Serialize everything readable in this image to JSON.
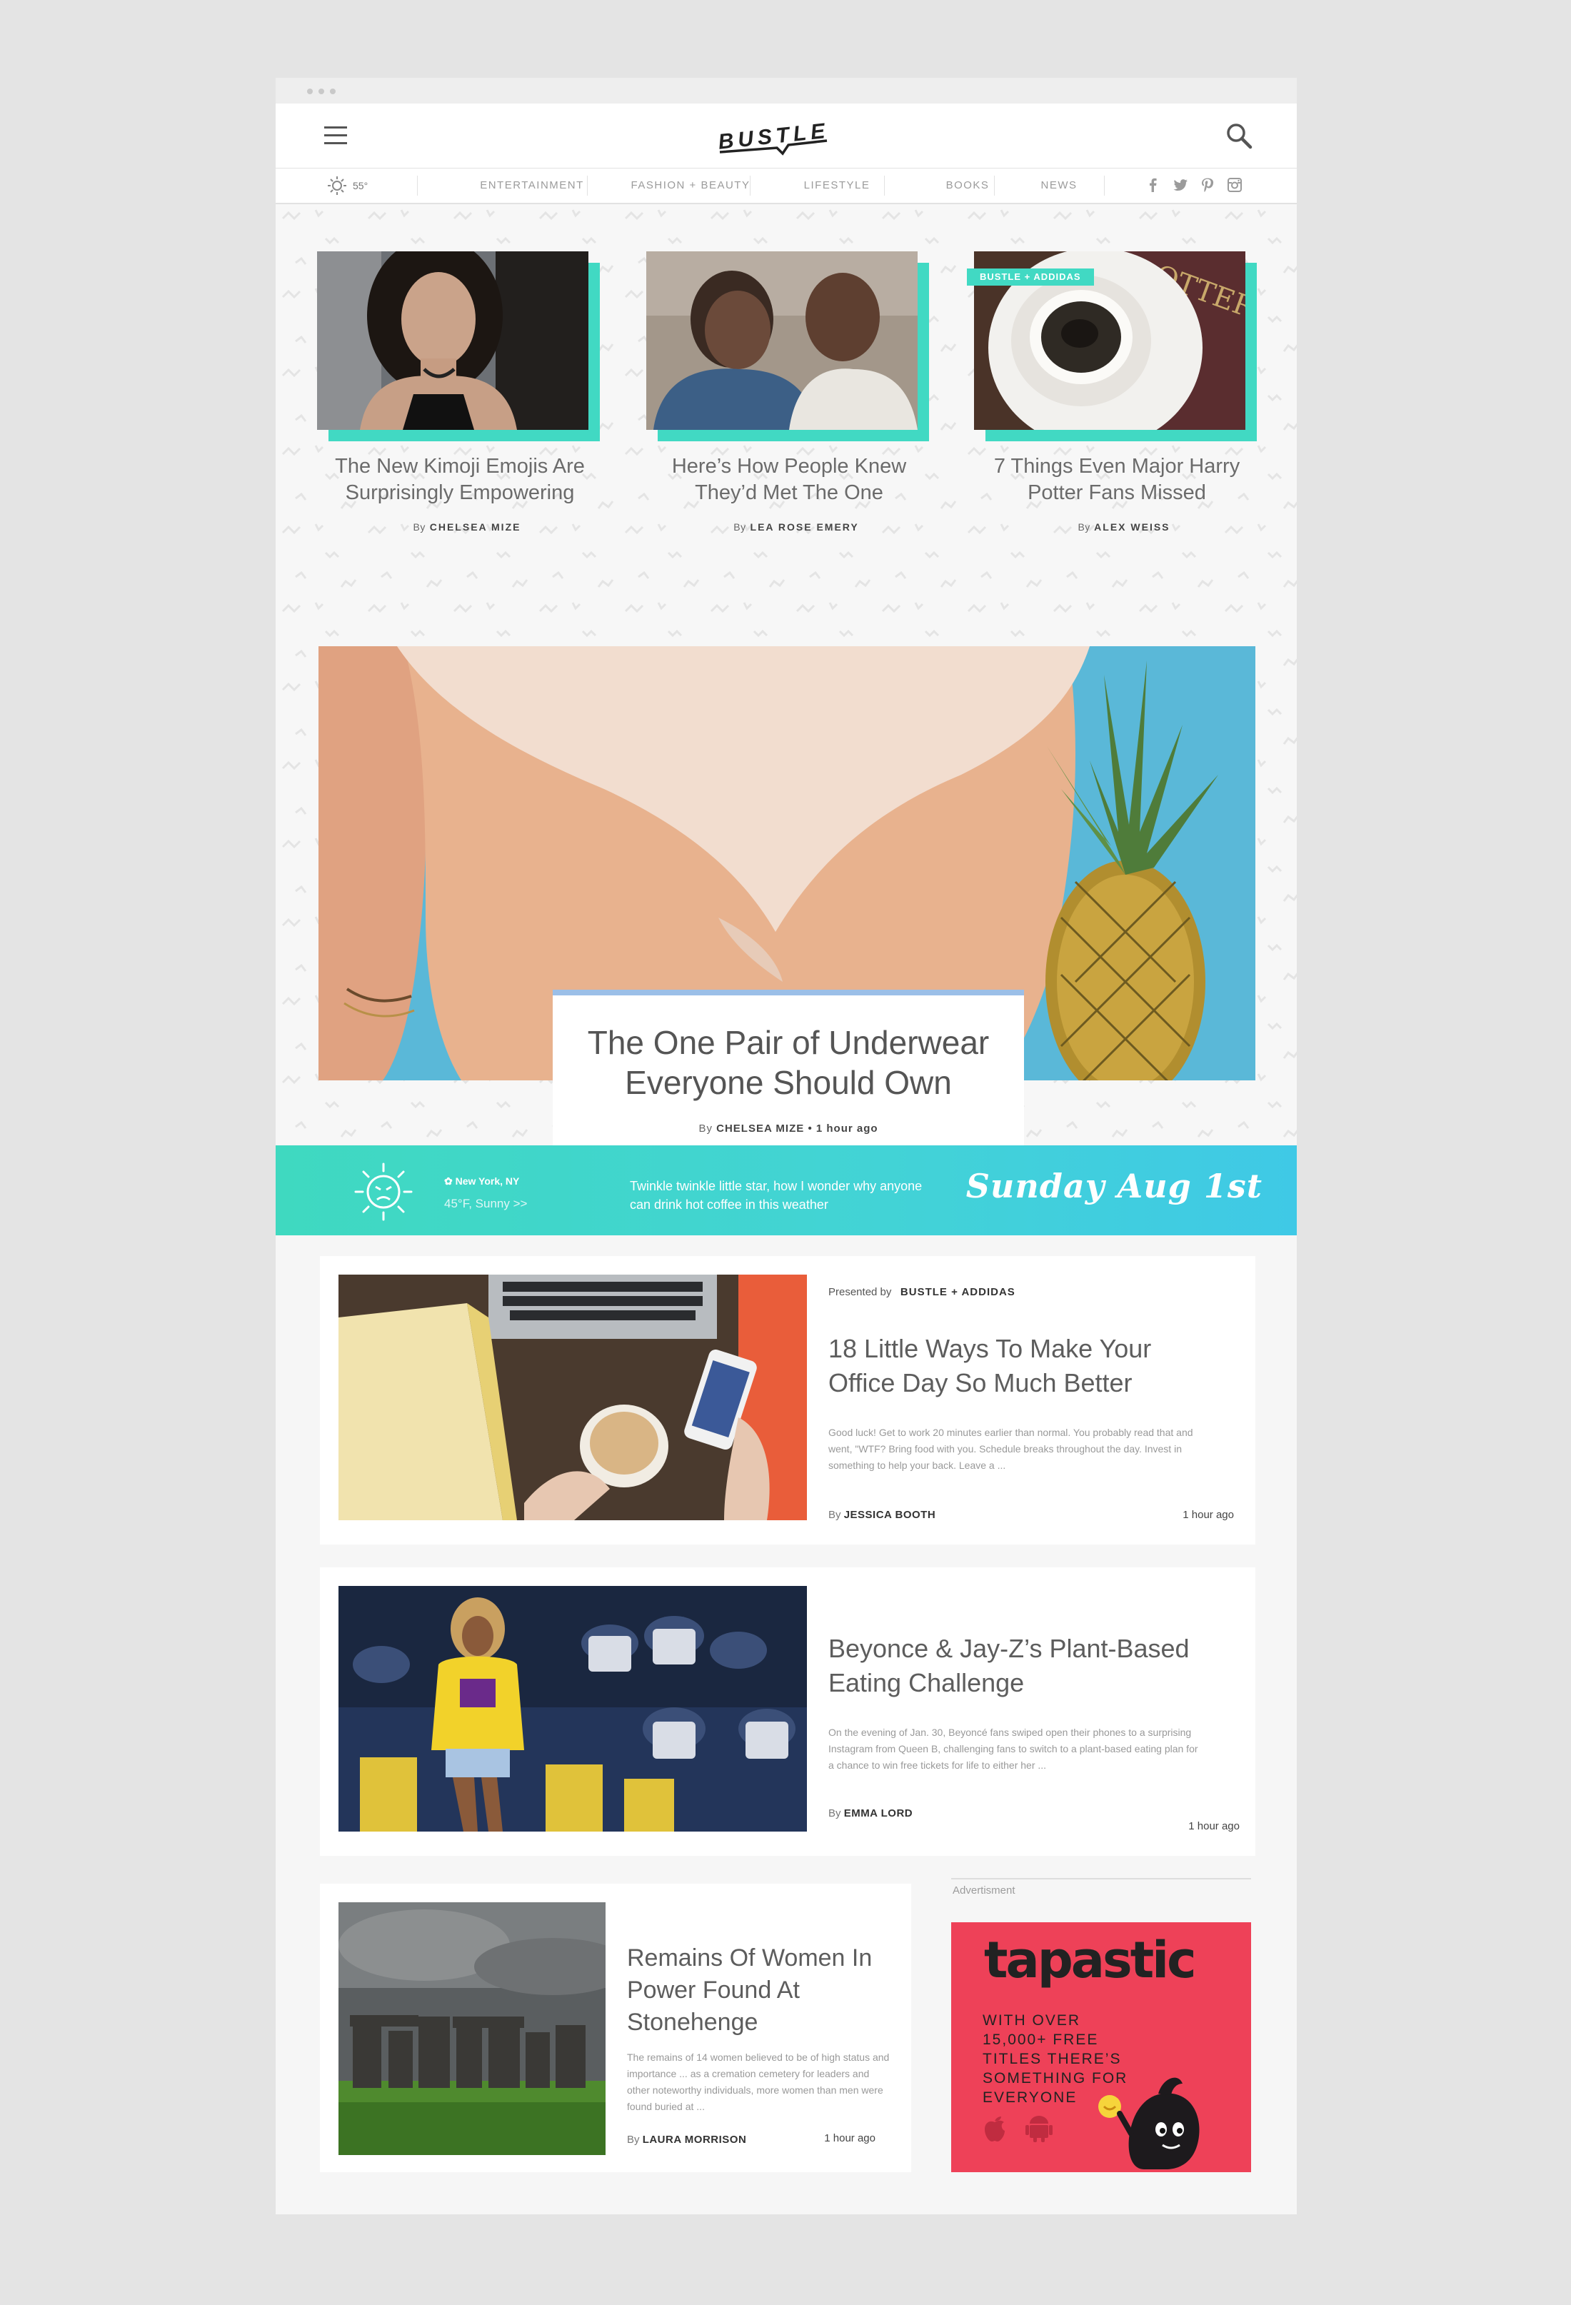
{
  "header": {
    "logo_text": "BUSTLE"
  },
  "nav": {
    "temperature": "55°",
    "items": [
      "ENTERTAINMENT",
      "FASHION + BEAUTY",
      "LIFESTYLE",
      "BOOKS",
      "NEWS"
    ],
    "social_icons": [
      "facebook-icon",
      "twitter-icon",
      "pinterest-icon",
      "instagram-icon"
    ]
  },
  "top_cards": [
    {
      "title": "The New Kimoji Emojis Are Surprisingly Empowering",
      "by": "By",
      "author": "CHELSEA MIZE"
    },
    {
      "title": "Here’s How People Knew They’d Met The One",
      "by": "By",
      "author": "LEA ROSE EMERY"
    },
    {
      "title": "7 Things Even Major Harry Potter Fans Missed",
      "by": "By",
      "author": "ALEX WEISS",
      "sponsor_tag": "BUSTLE + ADDIDAS"
    }
  ],
  "hero": {
    "title": "The One Pair of Underwear Everyone Should Own",
    "by": "By",
    "author": "CHELSEA MIZE",
    "dot": "•",
    "time": "1 hour ago"
  },
  "weather_band": {
    "location": "New York, NY",
    "conditions": "45°F, Sunny >>",
    "quote": "Twinkle twinkle little star, how I wonder why anyone can drink hot coffee in this weather",
    "date": "Sunday Aug 1st"
  },
  "articles": [
    {
      "presented_by": "Presented by",
      "sponsor": "BUSTLE + ADDIDAS",
      "title": "18 Little Ways To Make Your Office Day So Much Better",
      "excerpt": "Good luck! Get to work 20 minutes earlier than normal. You probably read that and went, \"WTF? Bring food with you. Schedule breaks throughout the day. Invest in something to help your back. Leave a ...",
      "by": "By",
      "author": "JESSICA BOOTH",
      "time": "1 hour ago"
    },
    {
      "title": "Beyonce & Jay-Z’s Plant-Based Eating Challenge",
      "excerpt": "On the evening of Jan. 30, Beyoncé fans swiped open their phones to a surprising Instagram from Queen B, challenging fans to switch to a plant-based eating plan for a chance to win free tickets for life to either her ...",
      "by": "By",
      "author": "EMMA LORD",
      "time": "1 hour ago"
    },
    {
      "title": "Remains Of Women In Power Found At Stonehenge",
      "excerpt": "The remains of 14 women believed to be of high status and importance ... as a cremation cemetery for leaders and other noteworthy individuals, more women than men were found buried at ...",
      "by": "By",
      "author": "LAURA MORRISON",
      "time": "1 hour ago"
    }
  ],
  "ad": {
    "label": "Advertisment",
    "brand": "tapastic",
    "text": "WITH OVER 15,000+ FREE TITLES THERE’S SOMETHING FOR EVERYONE"
  },
  "colors": {
    "accent_teal": "#41d9c3",
    "band_blue": "#3fc9e6",
    "ad_red": "#ee4158"
  }
}
